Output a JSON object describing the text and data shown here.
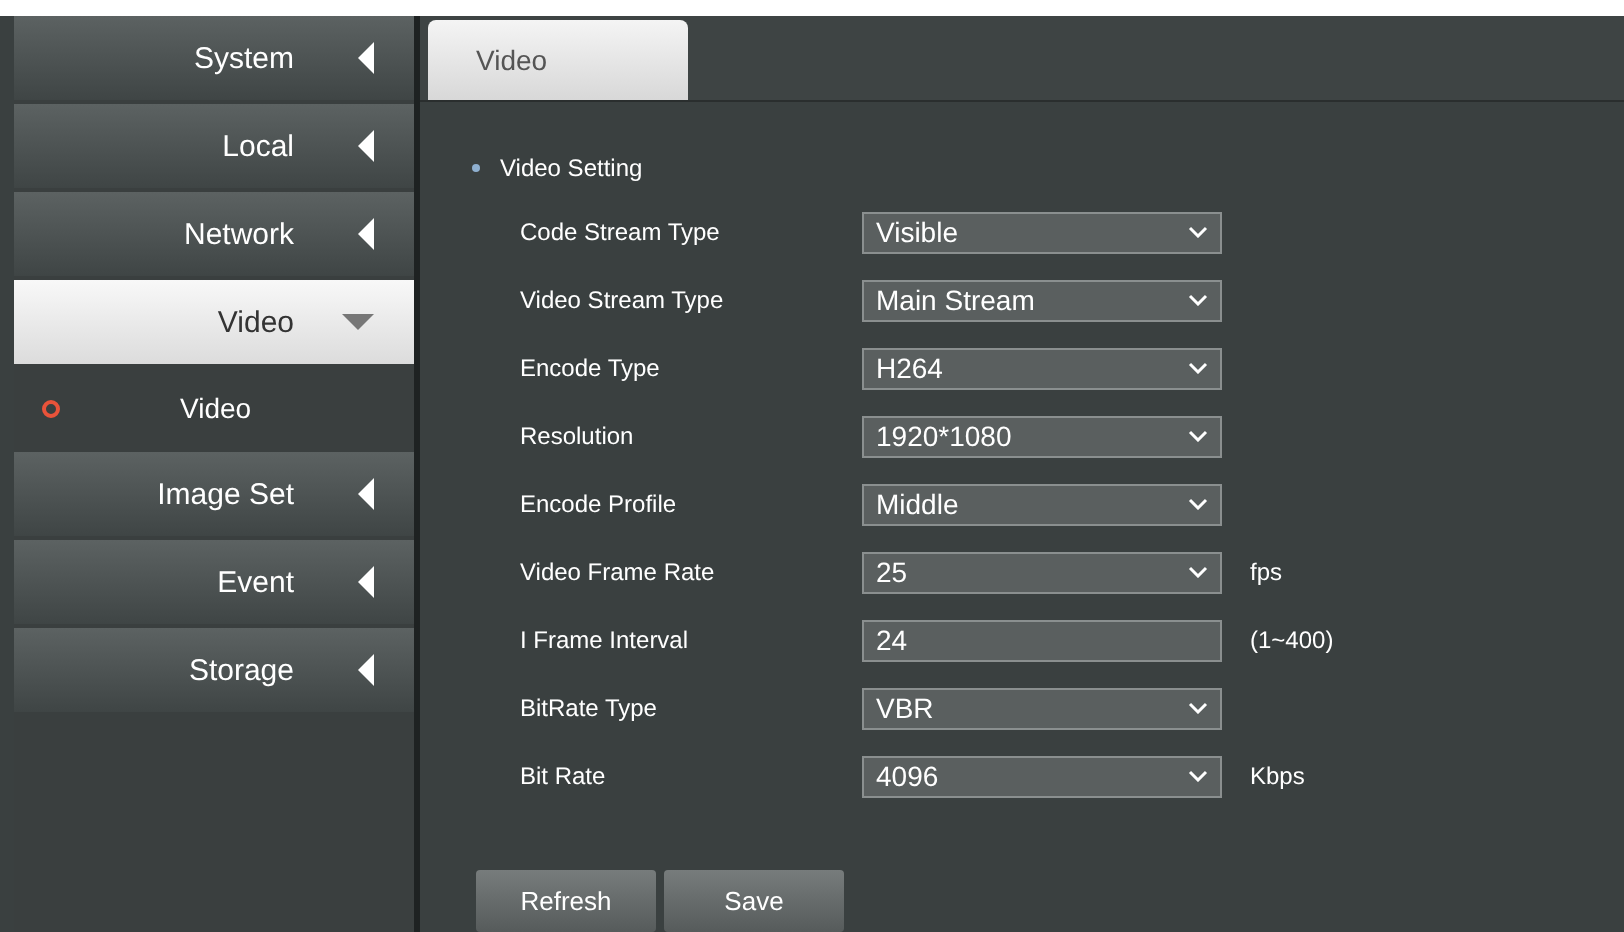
{
  "sidebar": {
    "items": [
      {
        "kind": "menu",
        "label": "System",
        "expanded": false
      },
      {
        "kind": "menu",
        "label": "Local",
        "expanded": false
      },
      {
        "kind": "menu",
        "label": "Network",
        "expanded": false
      },
      {
        "kind": "menu",
        "label": "Video",
        "expanded": true
      },
      {
        "kind": "sub",
        "label": "Video",
        "selected": true
      },
      {
        "kind": "menu",
        "label": "Image Set",
        "expanded": false
      },
      {
        "kind": "menu",
        "label": "Event",
        "expanded": false
      },
      {
        "kind": "menu",
        "label": "Storage",
        "expanded": false
      }
    ]
  },
  "tabs": [
    {
      "label": "Video",
      "selected": true
    }
  ],
  "section": {
    "title": "Video Setting"
  },
  "fields": [
    {
      "kind": "select",
      "label": "Code Stream Type",
      "value": "Visible"
    },
    {
      "kind": "select",
      "label": "Video Stream Type",
      "value": "Main Stream"
    },
    {
      "kind": "select",
      "label": "Encode Type",
      "value": "H264"
    },
    {
      "kind": "select",
      "label": "Resolution",
      "value": "1920*1080"
    },
    {
      "kind": "select",
      "label": "Encode Profile",
      "value": "Middle"
    },
    {
      "kind": "select",
      "label": "Video Frame Rate",
      "value": "25",
      "unit": "fps"
    },
    {
      "kind": "text",
      "label": "I Frame Interval",
      "value": "24",
      "unit": "(1~400)"
    },
    {
      "kind": "select",
      "label": "BitRate Type",
      "value": "VBR"
    },
    {
      "kind": "select",
      "label": "Bit Rate",
      "value": "4096",
      "unit": "Kbps"
    }
  ],
  "buttons": [
    "Refresh",
    "Save"
  ]
}
